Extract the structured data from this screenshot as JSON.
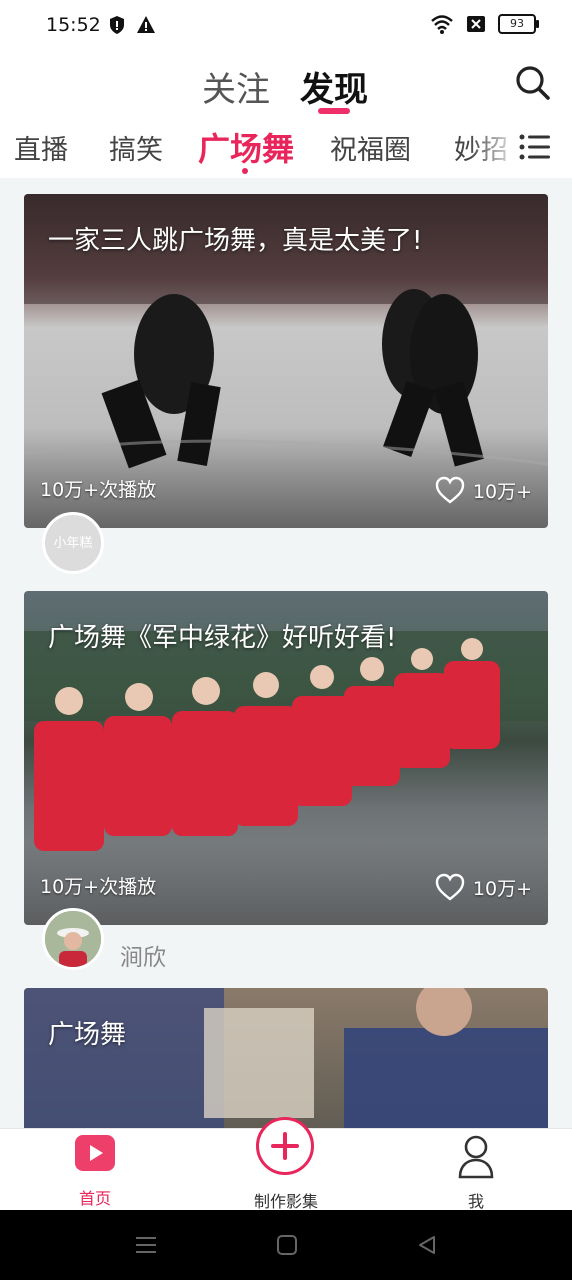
{
  "status_bar": {
    "time": "15:52",
    "battery": "93",
    "icons_left": [
      "shield-icon",
      "warning-icon"
    ],
    "icons_right": [
      "wifi-icon",
      "sim-off-icon",
      "battery-icon"
    ]
  },
  "header": {
    "tab_follow": "关注",
    "tab_discover": "发现",
    "active_tab": "发现",
    "accent_color": "#ee2f69"
  },
  "categories": {
    "items": [
      "直播",
      "搞笑",
      "广场舞",
      "祝福圈",
      "妙招"
    ],
    "active": "广场舞"
  },
  "feed": {
    "cards": [
      {
        "title": "一家三人跳广场舞，真是太美了!",
        "plays": "10万+次播放",
        "likes": "10万+",
        "avatar_text": "小年糕",
        "author": ""
      },
      {
        "title": "广场舞《军中绿花》好听好看!",
        "plays": "10万+次播放",
        "likes": "10万+",
        "author": "涧欣"
      },
      {
        "title": "广场舞"
      }
    ]
  },
  "bottom_nav": {
    "home": "首页",
    "make": "制作影集",
    "me": "我"
  }
}
